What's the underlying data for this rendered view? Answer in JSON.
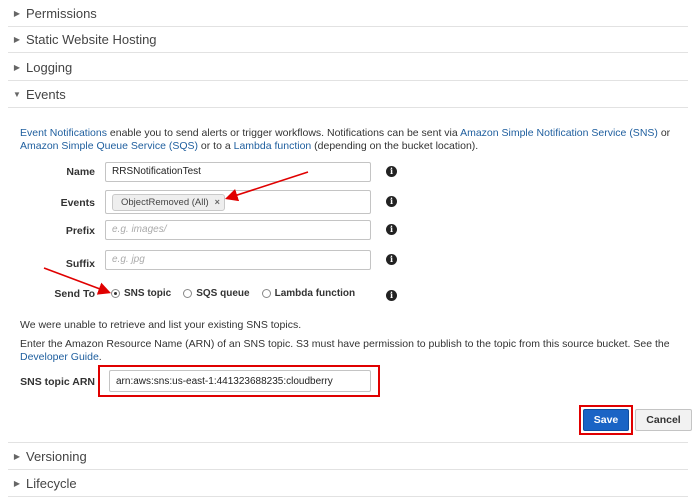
{
  "sections_top": [
    {
      "label": "Permissions"
    },
    {
      "label": "Static Website Hosting"
    },
    {
      "label": "Logging"
    }
  ],
  "events_section": {
    "label": "Events"
  },
  "intro": {
    "link1": "Event Notifications",
    "text1": " enable you to send alerts or trigger workflows. Notifications can be sent via ",
    "link2": "Amazon Simple Notification Service (SNS)",
    "text2": " or ",
    "link3": "Amazon Simple Queue Service (SQS)",
    "text3": " or to a ",
    "link4": "Lambda function",
    "text4": " (depending on the bucket location)."
  },
  "form": {
    "name_label": "Name",
    "name_value": "RRSNotificationTest",
    "events_label": "Events",
    "events_tag": "ObjectRemoved (All)",
    "events_tag_remove": "×",
    "prefix_label": "Prefix",
    "prefix_placeholder": "e.g. images/",
    "suffix_label": "Suffix",
    "suffix_placeholder": "e.g. jpg",
    "send_to_label": "Send To",
    "send_to_options": [
      "SNS topic",
      "SQS queue",
      "Lambda function"
    ],
    "send_to_selected": "SNS topic"
  },
  "info_glyph": "i",
  "notes": {
    "unable": "We were unable to retrieve and list your existing SNS topics.",
    "enter_arn": "Enter the Amazon Resource Name (ARN) of an SNS topic. S3 must have permission to publish to the topic from this source bucket. See the ",
    "developer_guide": "Developer Guide",
    "period": "."
  },
  "arn": {
    "label": "SNS topic ARN",
    "value": "arn:aws:sns:us-east-1:441323688235:cloudberry"
  },
  "buttons": {
    "save": "Save",
    "cancel": "Cancel"
  },
  "sections_bottom": [
    {
      "label": "Versioning"
    },
    {
      "label": "Lifecycle"
    }
  ],
  "colors": {
    "link": "#1e5e9e",
    "highlight": "#e00000",
    "save_button": "#1a64c5"
  }
}
